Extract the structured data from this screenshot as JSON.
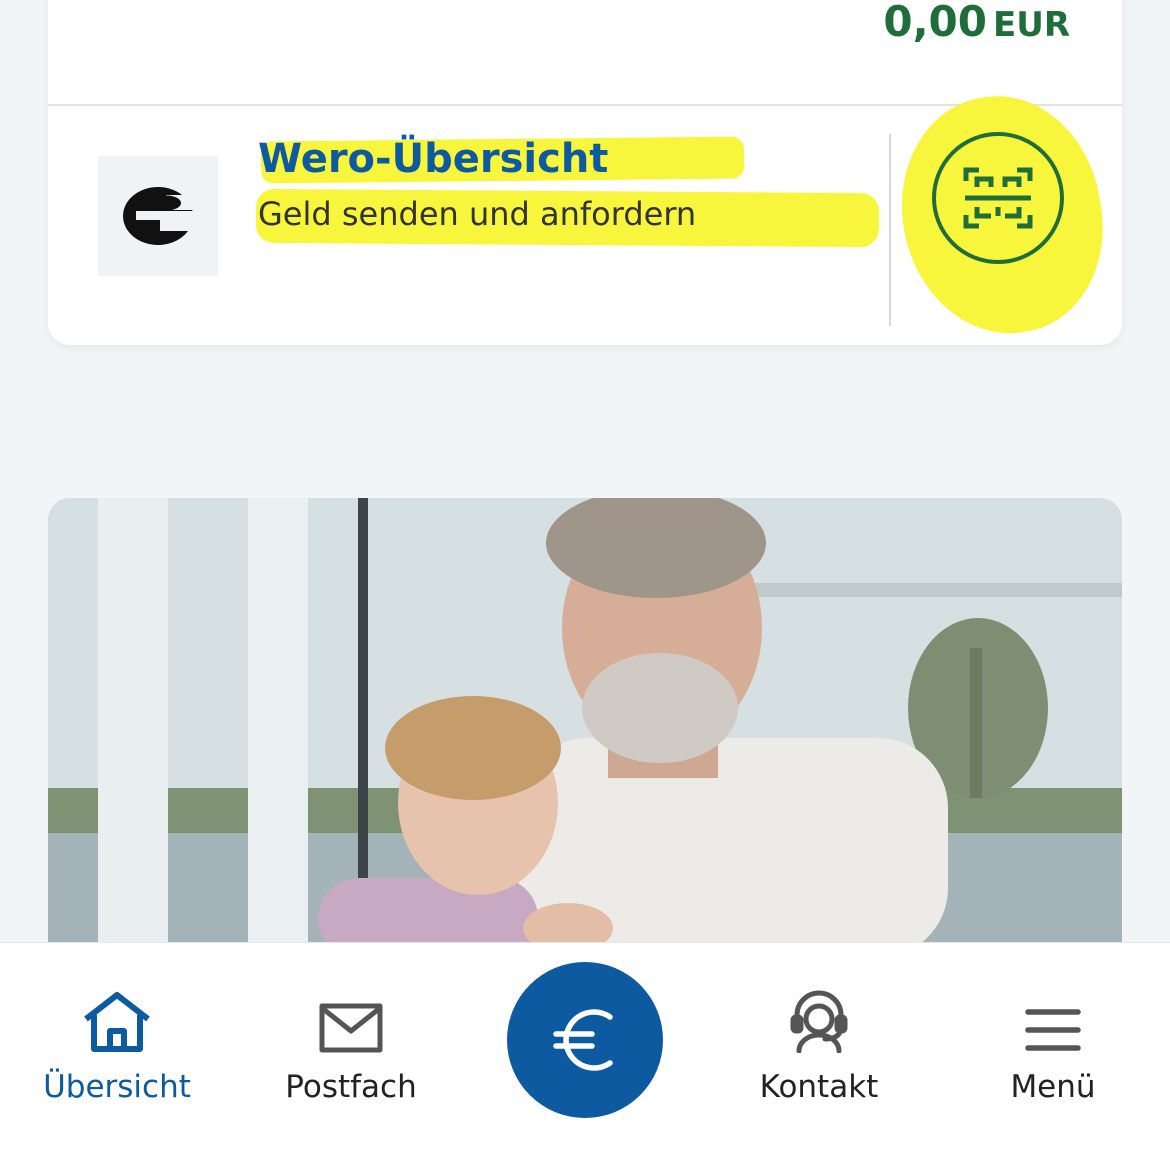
{
  "balance": {
    "amount": "0,00",
    "currency": "EUR"
  },
  "wero": {
    "title": "Wero-Übersicht",
    "subtitle": "Geld senden und anfordern",
    "logo_icon": "wero-e-logo-icon",
    "qr_icon": "qr-scan-icon"
  },
  "colors": {
    "brand_blue": "#0d5aa0",
    "balance_green": "#1f6e3a",
    "highlight_yellow": "#f8f531",
    "background": "#f2f5f6"
  },
  "nav": {
    "items": [
      {
        "label": "Übersicht",
        "icon": "home-icon",
        "active": true
      },
      {
        "label": "Postfach",
        "icon": "mail-icon",
        "active": false
      },
      {
        "label": "",
        "icon": "euro-icon",
        "active": false
      },
      {
        "label": "Kontakt",
        "icon": "headset-icon",
        "active": false
      },
      {
        "label": "Menü",
        "icon": "hamburger-menu-icon",
        "active": false
      }
    ]
  }
}
